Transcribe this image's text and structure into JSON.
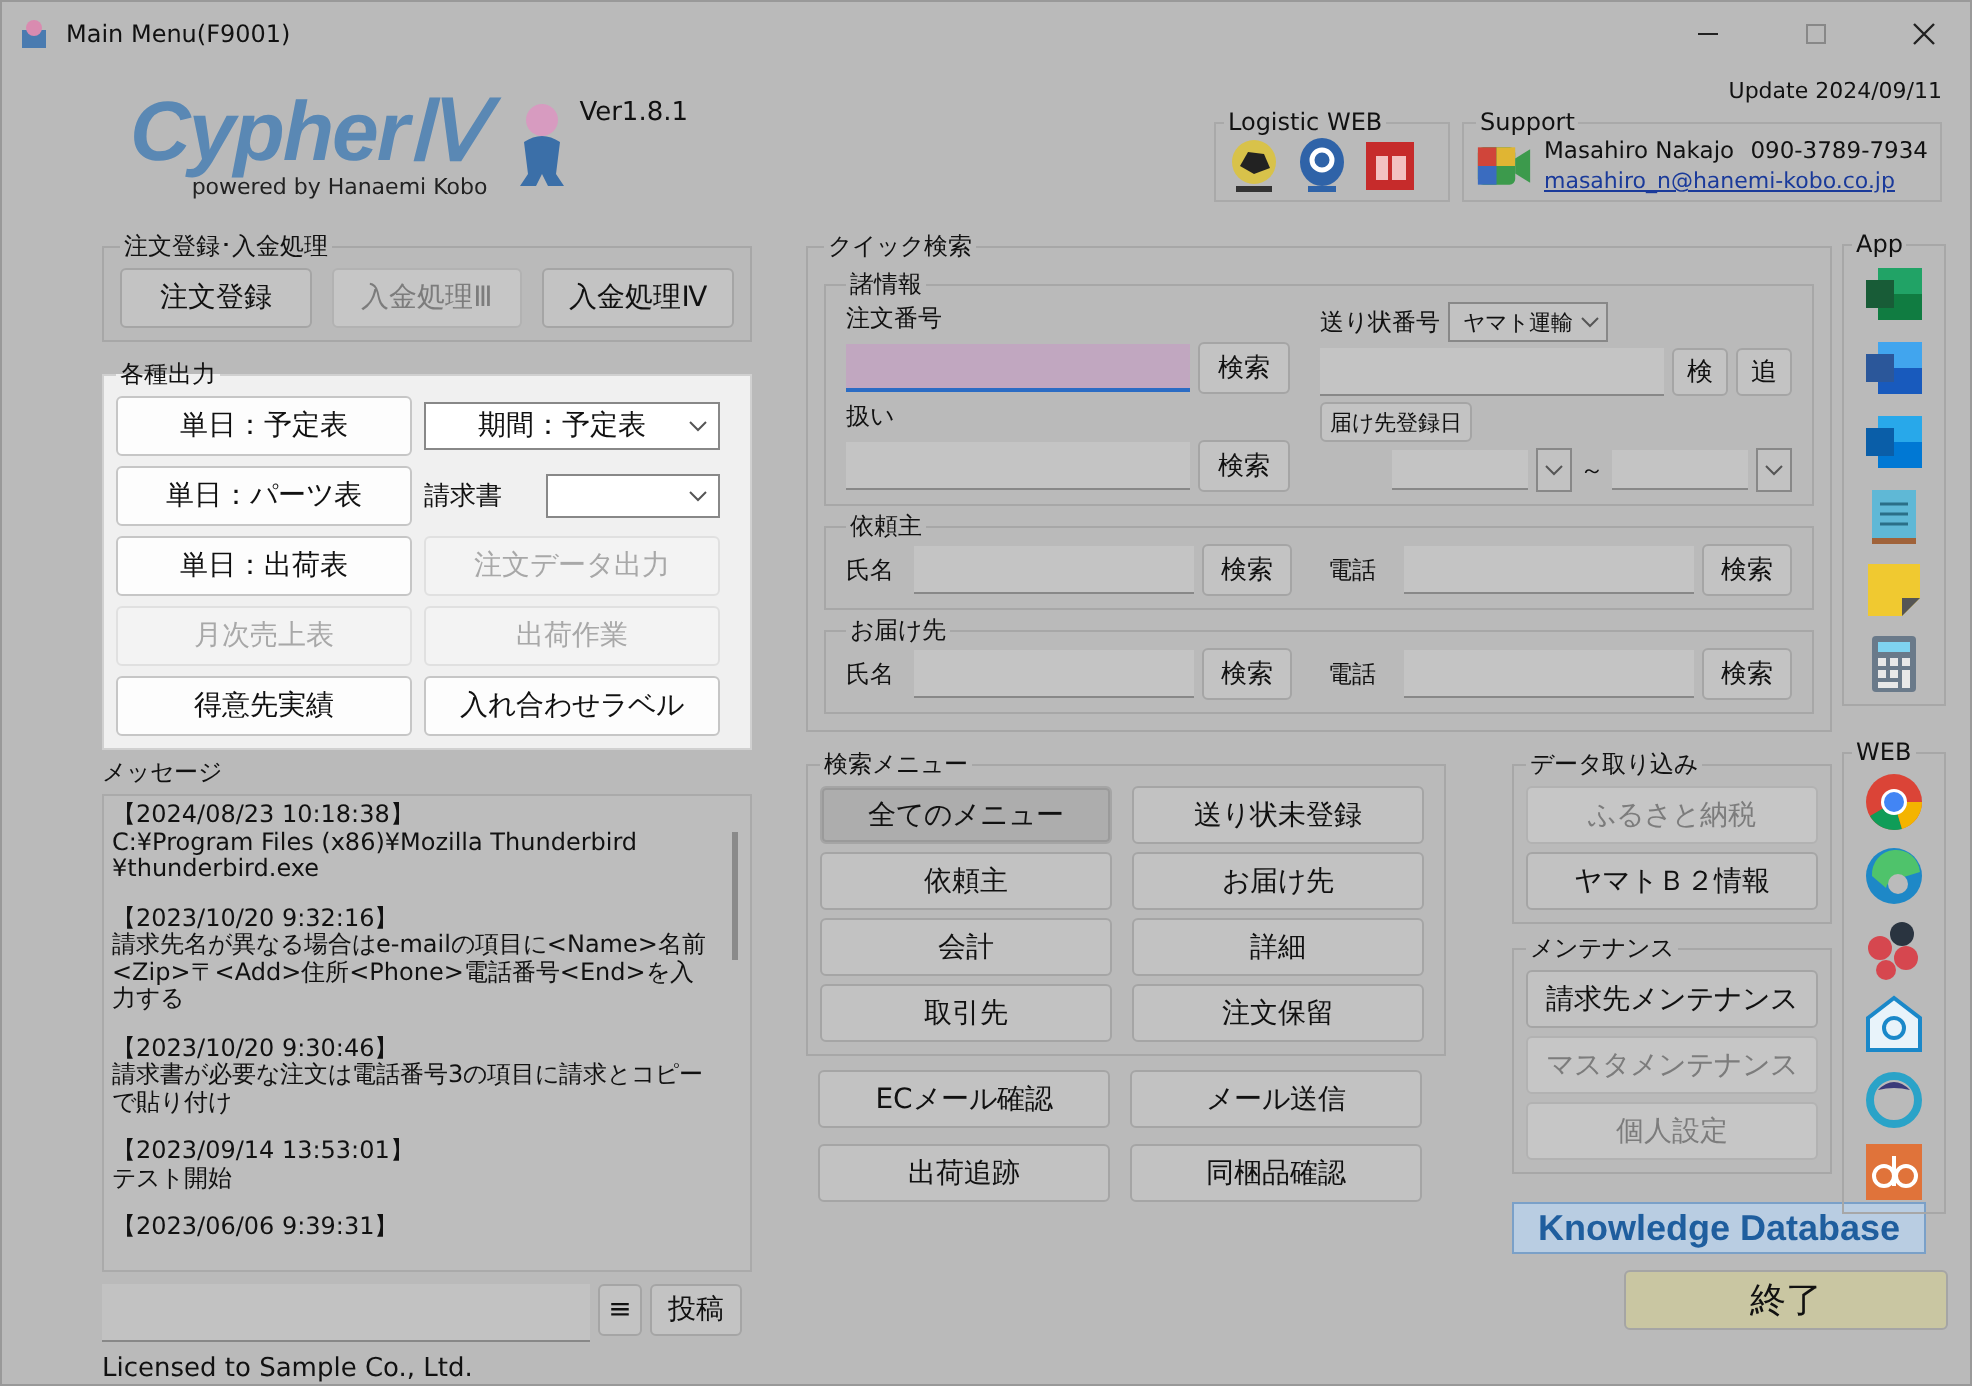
{
  "window": {
    "title": "Main Menu(F9001)"
  },
  "header": {
    "logo": "CypherⅣ",
    "tagline": "powered by Hanaemi Kobo",
    "version": "Ver1.8.1",
    "update": "Update 2024/09/11"
  },
  "logistic_web": {
    "title": "Logistic WEB"
  },
  "support": {
    "title": "Support",
    "name": "Masahiro Nakajo",
    "phone": "090-3789-7934",
    "email": "masahiro_n@hanemi-kobo.co.jp"
  },
  "order_panel": {
    "title": "注文登録･入金処理",
    "buttons": [
      {
        "label": "注文登録",
        "disabled": false
      },
      {
        "label": "入金処理Ⅲ",
        "disabled": true
      },
      {
        "label": "入金処理Ⅳ",
        "disabled": false
      }
    ]
  },
  "output_panel": {
    "title": "各種出力",
    "highlighted": true,
    "items": [
      {
        "kind": "button",
        "label": "単日：予定表",
        "disabled": false
      },
      {
        "kind": "select",
        "value": "期間：予定表"
      },
      {
        "kind": "button",
        "label": "単日：パーツ表",
        "disabled": false
      },
      {
        "kind": "labeled_select",
        "label": "請求書"
      },
      {
        "kind": "button",
        "label": "単日：出荷表",
        "disabled": false
      },
      {
        "kind": "button",
        "label": "注文データ出力",
        "disabled": true
      },
      {
        "kind": "button",
        "label": "月次売上表",
        "disabled": true
      },
      {
        "kind": "button",
        "label": "出荷作業",
        "disabled": true
      },
      {
        "kind": "button",
        "label": "得意先実績",
        "disabled": false
      },
      {
        "kind": "button",
        "label": "入れ合わせラベル",
        "disabled": false
      }
    ]
  },
  "messages": {
    "title": "メッセージ",
    "entries": [
      {
        "time": "【2024/08/23 10:18:38】",
        "text": "C:¥Program Files (x86)¥Mozilla Thunderbird ¥thunderbird.exe"
      },
      {
        "time": "【2023/10/20 9:32:16】",
        "text": "請求先名が異なる場合はe-mailの項目に<Name>名前<Zip>〒<Add>住所<Phone>電話番号<End>を入力する"
      },
      {
        "time": "【2023/10/20 9:30:46】",
        "text": "請求書が必要な注文は電話番号3の項目に請求とコピーで貼り付け"
      },
      {
        "time": "【2023/09/14 13:53:01】",
        "text": "テスト開始"
      },
      {
        "time": "【2023/06/06 9:39:31】"
      }
    ],
    "menu_button": "≡",
    "post_button": "投稿"
  },
  "license": "Licensed to Sample Co., Ltd.",
  "quick_search": {
    "title": "クイック検索",
    "info": {
      "title": "諸情報",
      "order_label": "注文番号",
      "order_focused": true,
      "order_search": "検索",
      "handling_label": "扱い",
      "handling_search": "検索",
      "tracking_label": "送り状番号",
      "carrier": "ヤマト運輸",
      "tracking_search": "検",
      "tracking_add": "追",
      "date_button": "届け先登録日",
      "range_sep": "～"
    },
    "groups": [
      {
        "title": "依頼主",
        "name_label": "氏名",
        "name_search": "検索",
        "phone_label": "電話",
        "phone_search": "検索"
      },
      {
        "title": "お届け先",
        "name_label": "氏名",
        "name_search": "検索",
        "phone_label": "電話",
        "phone_search": "検索"
      }
    ]
  },
  "search_menu": {
    "title": "検索メニュー",
    "buttons": [
      {
        "label": "全てのメニュー",
        "selected": true
      },
      {
        "label": "送り状未登録",
        "selected": false
      },
      {
        "label": "依頼主",
        "selected": false
      },
      {
        "label": "お届け先",
        "selected": false
      },
      {
        "label": "会計",
        "selected": false
      },
      {
        "label": "詳細",
        "selected": false
      },
      {
        "label": "取引先",
        "selected": false
      },
      {
        "label": "注文保留",
        "selected": false
      }
    ]
  },
  "extra_buttons": [
    "ECメール確認",
    "メール送信",
    "出荷追跡",
    "同梱品確認"
  ],
  "data_import": {
    "title": "データ取り込み",
    "buttons": [
      {
        "label": "ふるさと納税",
        "disabled": true
      },
      {
        "label": "ヤマトＢ２情報",
        "disabled": false
      }
    ]
  },
  "maintenance": {
    "title": "メンテナンス",
    "buttons": [
      {
        "label": "請求先メンテナンス",
        "disabled": false
      },
      {
        "label": "マスタメンテナンス",
        "disabled": true
      },
      {
        "label": "個人設定",
        "disabled": true
      }
    ]
  },
  "knowledge_button": "Knowledge Database",
  "exit_button": "終了",
  "app_panel": {
    "title": "App"
  },
  "web_panel": {
    "title": "WEB"
  }
}
